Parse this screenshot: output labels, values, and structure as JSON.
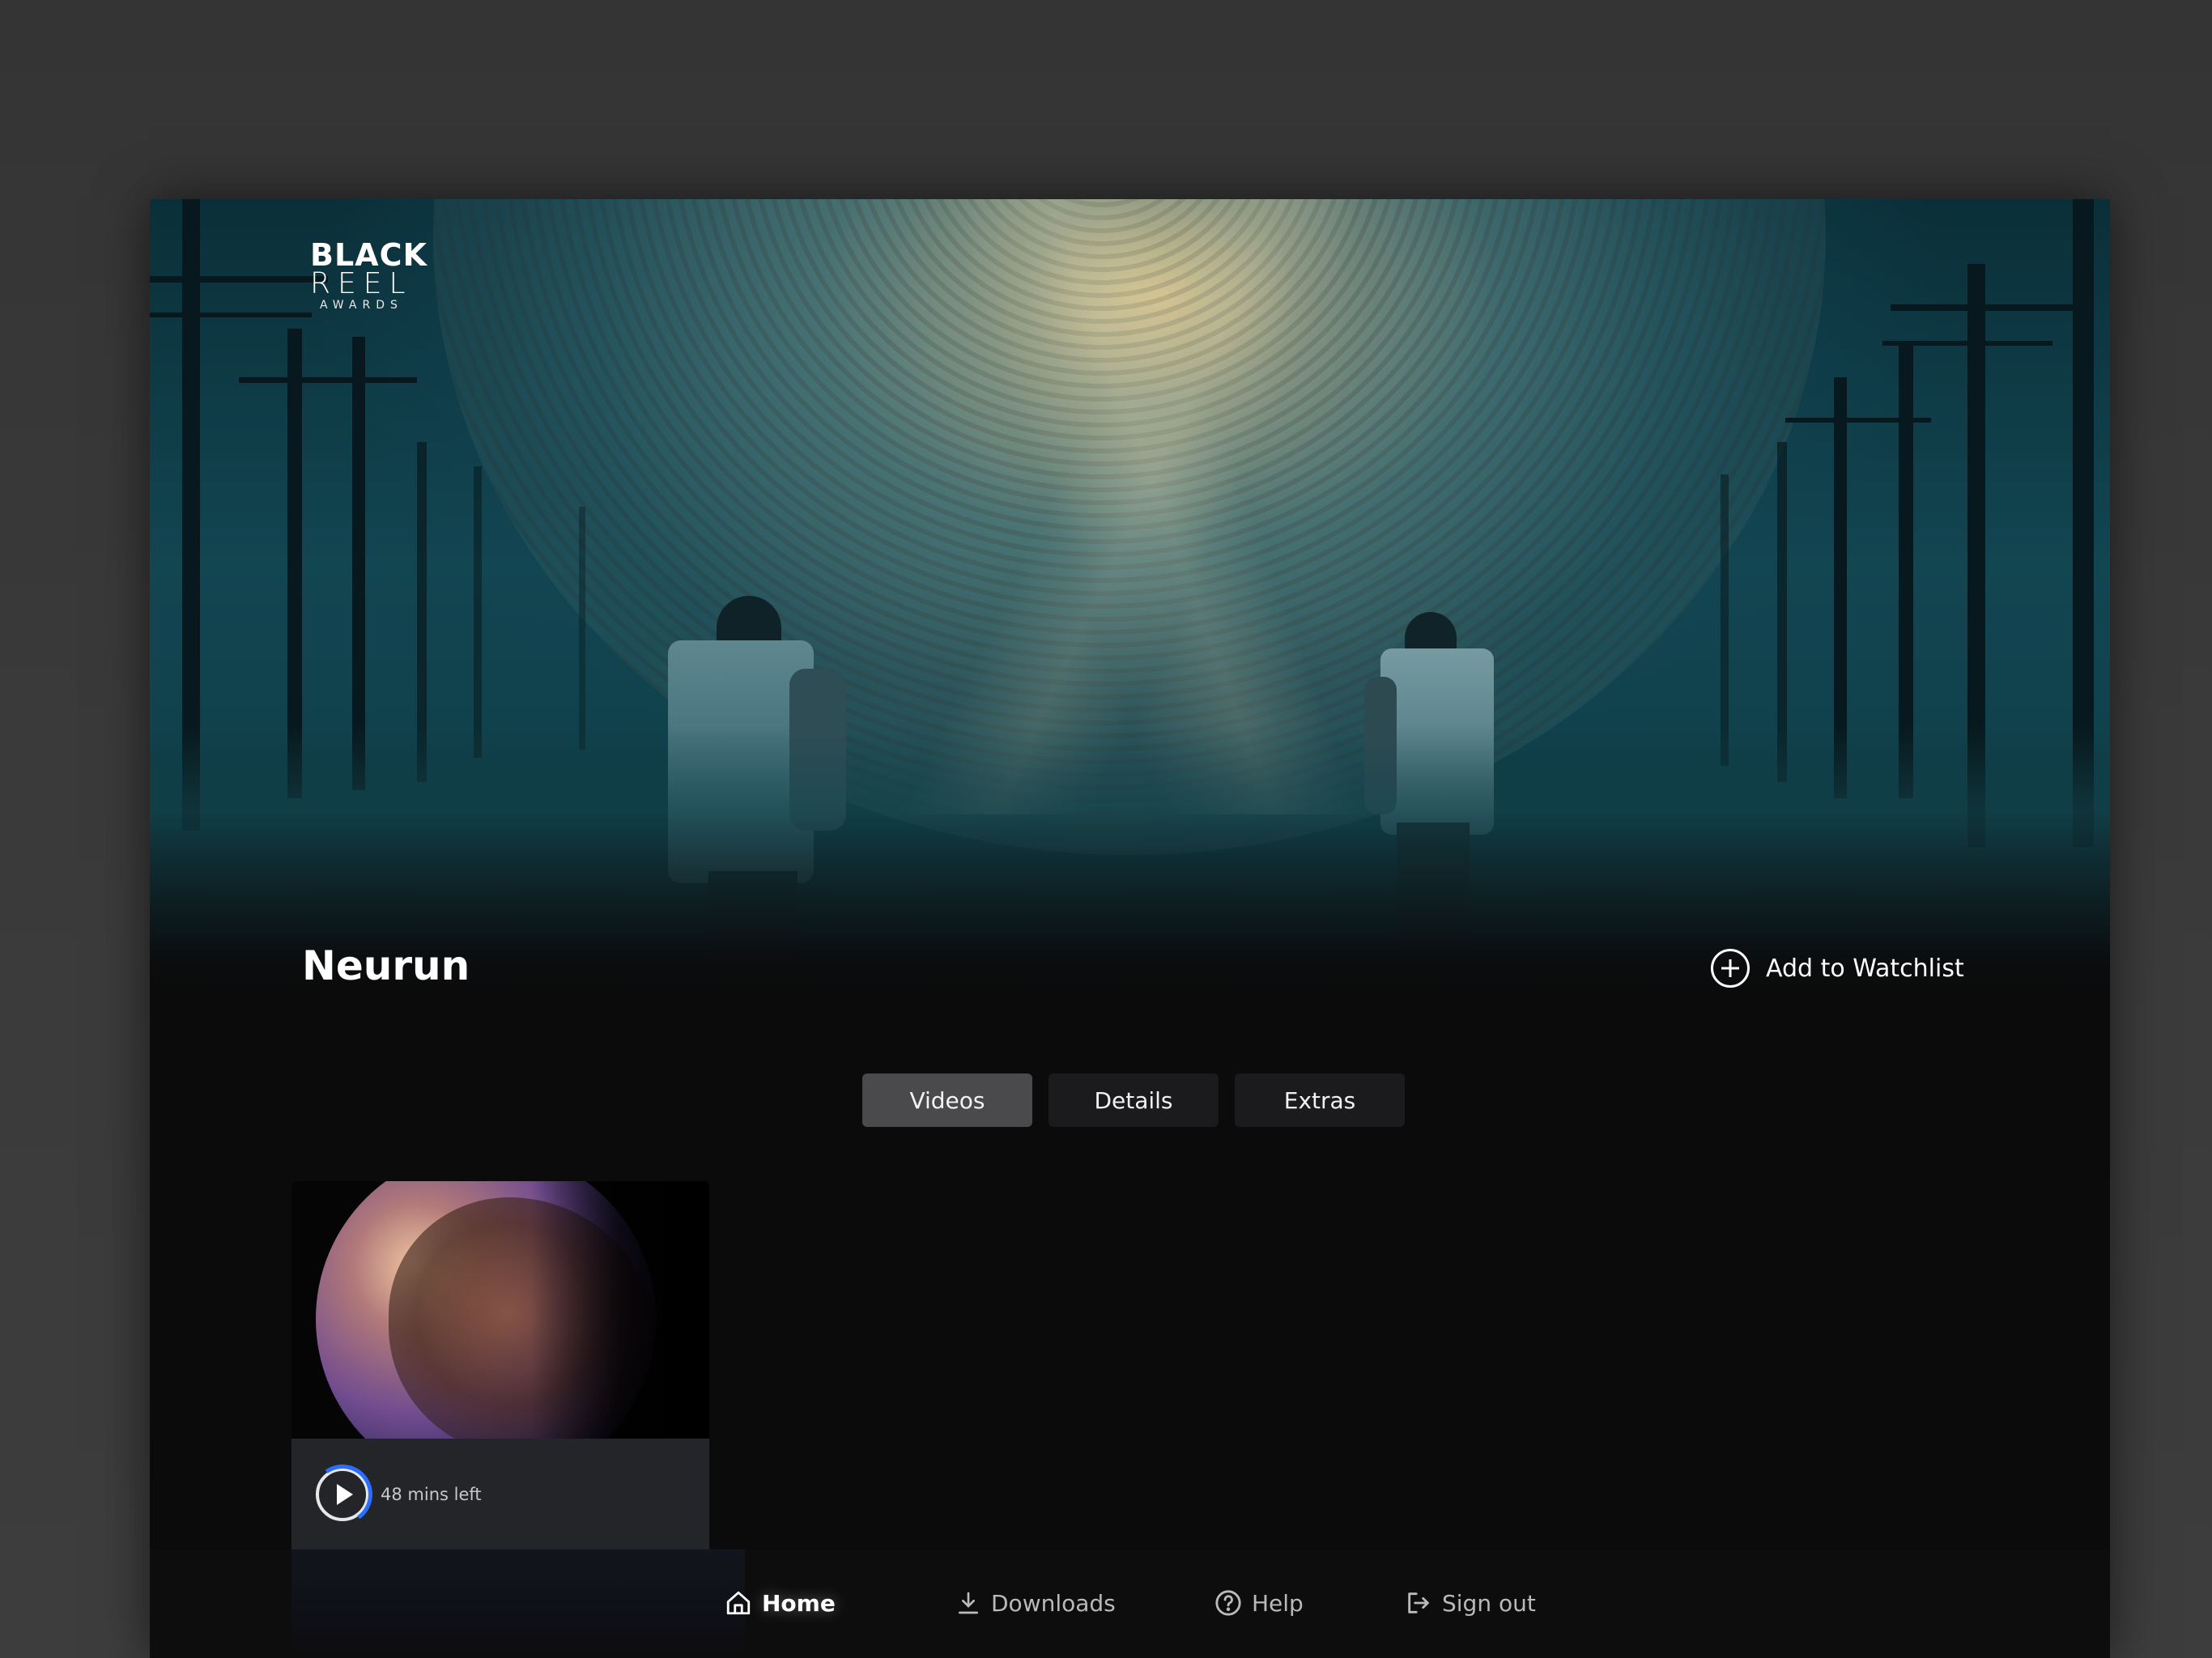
{
  "brand": {
    "logo_line1": "BLACK",
    "logo_line2": "REEL",
    "logo_line3": "AWARDS"
  },
  "hero": {
    "title": "Neurun",
    "watchlist_label": "Add to Watchlist"
  },
  "tabs": [
    {
      "label": "Videos",
      "active": true
    },
    {
      "label": "Details",
      "active": false
    },
    {
      "label": "Extras",
      "active": false
    }
  ],
  "video_card": {
    "time_left": "48 mins left",
    "progress_fraction": 0.25,
    "progress_color": "#2a6dff"
  },
  "bottom_nav": {
    "items": [
      {
        "label": "Home",
        "icon": "home-icon",
        "active": true
      },
      {
        "label": "Downloads",
        "icon": "download-icon",
        "active": false
      },
      {
        "label": "Help",
        "icon": "help-circle-icon",
        "active": false
      },
      {
        "label": "Sign out",
        "icon": "sign-out-icon",
        "active": false
      }
    ]
  },
  "colors": {
    "background": "#3a3a3a",
    "panel": "#0b0b0c",
    "tab_active": "#4a4a4c",
    "tab_inactive": "#1b1b1d",
    "card": "#242528"
  }
}
